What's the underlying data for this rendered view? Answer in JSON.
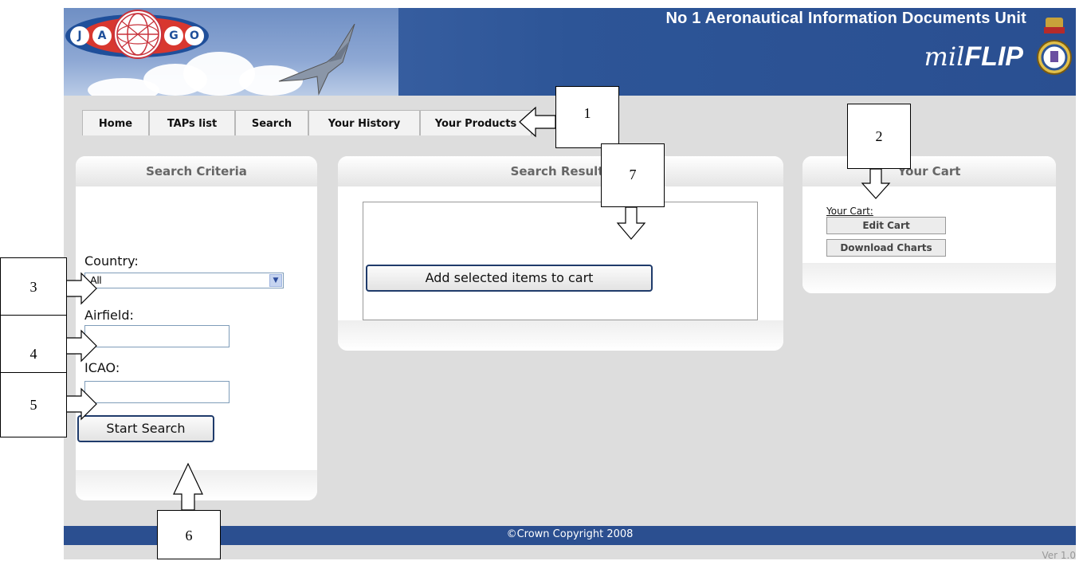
{
  "header": {
    "logo_letters": [
      "J",
      "A",
      "G",
      "O"
    ],
    "title": "No 1 Aeronautical Information Documents Unit",
    "brand_prefix": "mil",
    "brand_main": "FLIP"
  },
  "nav": {
    "tabs": [
      {
        "label": "Home"
      },
      {
        "label": "TAPs list"
      },
      {
        "label": "Search"
      },
      {
        "label": "Your History"
      },
      {
        "label": "Your Products"
      }
    ]
  },
  "search_panel": {
    "title": "Search Criteria",
    "country_label": "Country:",
    "country_value": "All",
    "airfield_label": "Airfield:",
    "airfield_value": "",
    "icao_label": "ICAO:",
    "icao_value": "",
    "search_button": "Start Search"
  },
  "results_panel": {
    "title": "Search Results",
    "add_button": "Add selected items to cart"
  },
  "cart_panel": {
    "title": "Your Cart",
    "cart_link": "Your Cart:",
    "edit_button": "Edit Cart",
    "download_button": "Download Charts"
  },
  "footer": {
    "copyright": "©Crown Copyright 2008",
    "version": "Ver 1.0"
  },
  "callouts": [
    "1",
    "2",
    "3",
    "4",
    "5",
    "6",
    "7"
  ],
  "colors": {
    "banner": "#2d5597",
    "footer": "#2b4f90",
    "page_bg": "#dddddd",
    "logo_red": "#d8372f"
  }
}
